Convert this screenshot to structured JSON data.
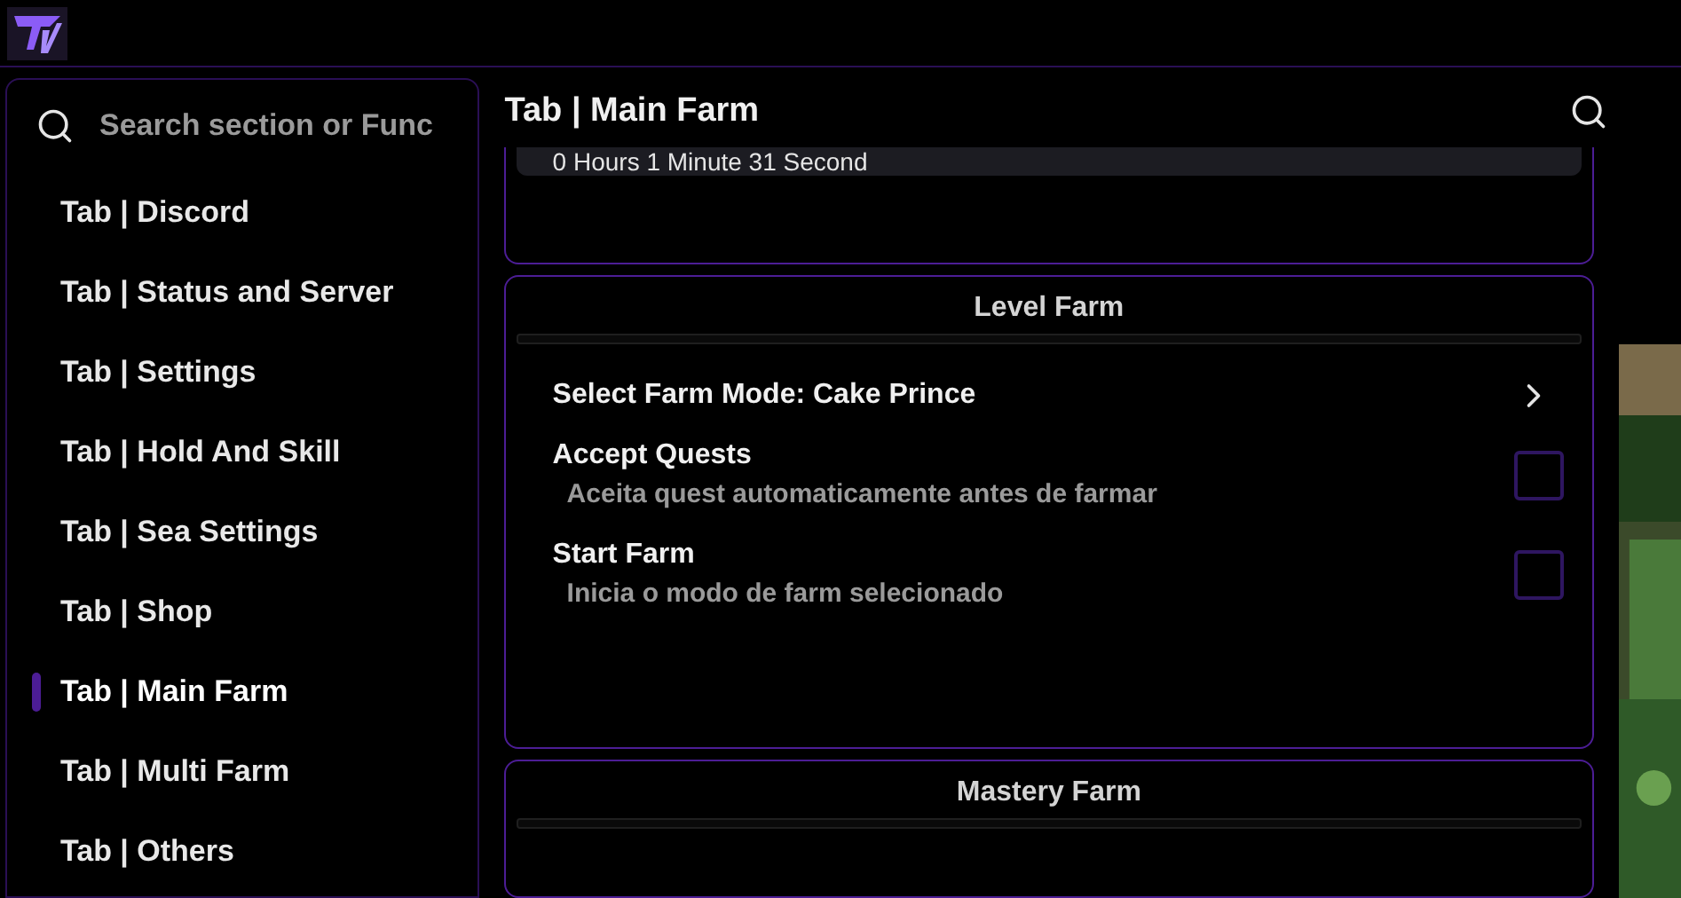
{
  "search": {
    "placeholder": "Search section or Func"
  },
  "sidebar": {
    "items": [
      {
        "label": "Tab | Discord",
        "selected": false
      },
      {
        "label": "Tab | Status and Server",
        "selected": false
      },
      {
        "label": "Tab | Settings",
        "selected": false
      },
      {
        "label": "Tab | Hold And Skill",
        "selected": false
      },
      {
        "label": "Tab | Sea Settings",
        "selected": false
      },
      {
        "label": "Tab | Shop",
        "selected": false
      },
      {
        "label": "Tab | Main Farm",
        "selected": true
      },
      {
        "label": "Tab | Multi Farm",
        "selected": false
      },
      {
        "label": "Tab | Others",
        "selected": false
      }
    ]
  },
  "header": {
    "title": "Tab | Main Farm"
  },
  "timer": {
    "value": "0 Hours 1 Minute 31 Second"
  },
  "sections": [
    {
      "title": "Level Farm",
      "rows": [
        {
          "kind": "dropdown",
          "label": "Select Farm Mode: Cake Prince"
        },
        {
          "kind": "toggle",
          "label": "Accept Quests",
          "description": "Aceita quest automaticamente antes de farmar",
          "checked": false
        },
        {
          "kind": "toggle",
          "label": "Start Farm",
          "description": "Inicia o modo de farm selecionado",
          "checked": false
        }
      ]
    },
    {
      "title": "Mastery Farm"
    }
  ]
}
